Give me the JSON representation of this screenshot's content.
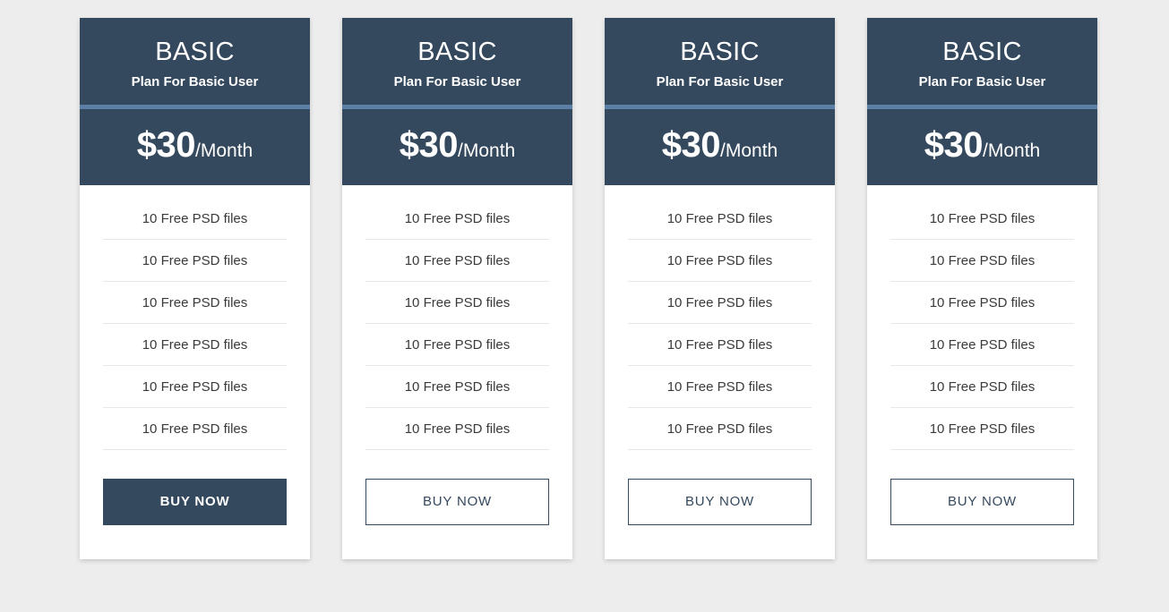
{
  "page": {
    "background_color": "#ededed",
    "title": "Pricing Table"
  },
  "theme": {
    "header_navy": "#35495e",
    "accent_blue": "#5b7fa6",
    "card_background": "#ffffff",
    "separator": "#e8e8e8",
    "feature_text": "#3a3a3a"
  },
  "cards": [
    {
      "plan_name": "BASIC",
      "tagline": "Plan For Basic User",
      "price_amount": "$30",
      "price_period": "/Month",
      "features": [
        "10 Free PSD files",
        "10 Free PSD files",
        "10 Free PSD files",
        "10 Free PSD files",
        "10 Free PSD files",
        "10 Free PSD files"
      ],
      "buy_label": "BUY NOW",
      "buy_style": "filled"
    },
    {
      "plan_name": "BASIC",
      "tagline": "Plan For Basic User",
      "price_amount": "$30",
      "price_period": "/Month",
      "features": [
        "10 Free PSD files",
        "10 Free PSD files",
        "10 Free PSD files",
        "10 Free PSD files",
        "10 Free PSD files",
        "10 Free PSD files"
      ],
      "buy_label": "BUY NOW",
      "buy_style": "outline"
    },
    {
      "plan_name": "BASIC",
      "tagline": "Plan For Basic User",
      "price_amount": "$30",
      "price_period": "/Month",
      "features": [
        "10 Free PSD files",
        "10 Free PSD files",
        "10 Free PSD files",
        "10 Free PSD files",
        "10 Free PSD files",
        "10 Free PSD files"
      ],
      "buy_label": "BUY NOW",
      "buy_style": "outline"
    },
    {
      "plan_name": "BASIC",
      "tagline": "Plan For Basic User",
      "price_amount": "$30",
      "price_period": "/Month",
      "features": [
        "10 Free PSD files",
        "10 Free PSD files",
        "10 Free PSD files",
        "10 Free PSD files",
        "10 Free PSD files",
        "10 Free PSD files"
      ],
      "buy_label": "BUY NOW",
      "buy_style": "outline"
    }
  ]
}
